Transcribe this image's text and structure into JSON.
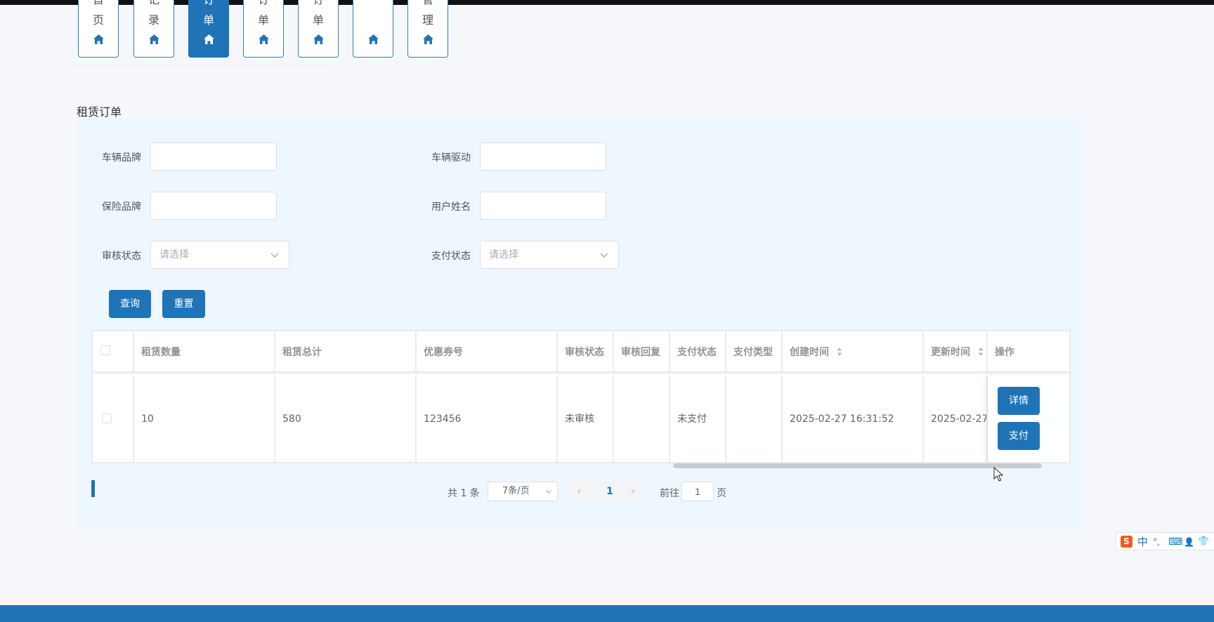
{
  "nav": {
    "tabs": [
      {
        "top": "首",
        "bottom": "页",
        "active": false
      },
      {
        "top": "记",
        "bottom": "录",
        "active": false
      },
      {
        "top": "订",
        "bottom": "单",
        "active": true
      },
      {
        "top": "订",
        "bottom": "单",
        "active": false
      },
      {
        "top": "订",
        "bottom": "单",
        "active": false
      },
      {
        "top": "",
        "bottom": "",
        "active": false
      },
      {
        "top": "管",
        "bottom": "理",
        "active": false
      }
    ]
  },
  "page": {
    "title": "租赁订单"
  },
  "search": {
    "brand_label": "车辆品牌",
    "brand_value": "",
    "drive_label": "车辆驱动",
    "drive_value": "",
    "insurance_label": "保险品牌",
    "insurance_value": "",
    "username_label": "用户姓名",
    "username_value": "",
    "audit_label": "审核状态",
    "audit_placeholder": "请选择",
    "pay_label": "支付状态",
    "pay_placeholder": "请选择",
    "query_button": "查询",
    "reset_button": "重置"
  },
  "table": {
    "headers": [
      "租赁数量",
      "租赁总计",
      "优惠券号",
      "审核状态",
      "审核回复",
      "支付状态",
      "支付类型",
      "创建时间",
      "更新时间",
      "操作"
    ],
    "rows": [
      {
        "quantity": "10",
        "total": "580",
        "coupon": "123456",
        "audit_status": "未审核",
        "audit_reply": "",
        "pay_status": "未支付",
        "pay_type": "",
        "created": "2025-02-27 16:31:52",
        "updated": "2025-02-27",
        "detail_button": "详情",
        "pay_button": "支付"
      }
    ]
  },
  "pagination": {
    "total_text": "共 1 条",
    "page_size": "7条/页",
    "current_page": "1",
    "prev_icon": "‹",
    "next_icon": "›",
    "goto_label": "前往",
    "goto_value": "1",
    "page_suffix": "页"
  },
  "ime": {
    "logo": "S",
    "lang": "中",
    "punct": "°,",
    "keyboard": "⌨",
    "user": "👤",
    "skin": "👕"
  },
  "colors": {
    "primary": "#1f74b8",
    "panel": "#eef6fe",
    "background": "#f5f7fa"
  }
}
